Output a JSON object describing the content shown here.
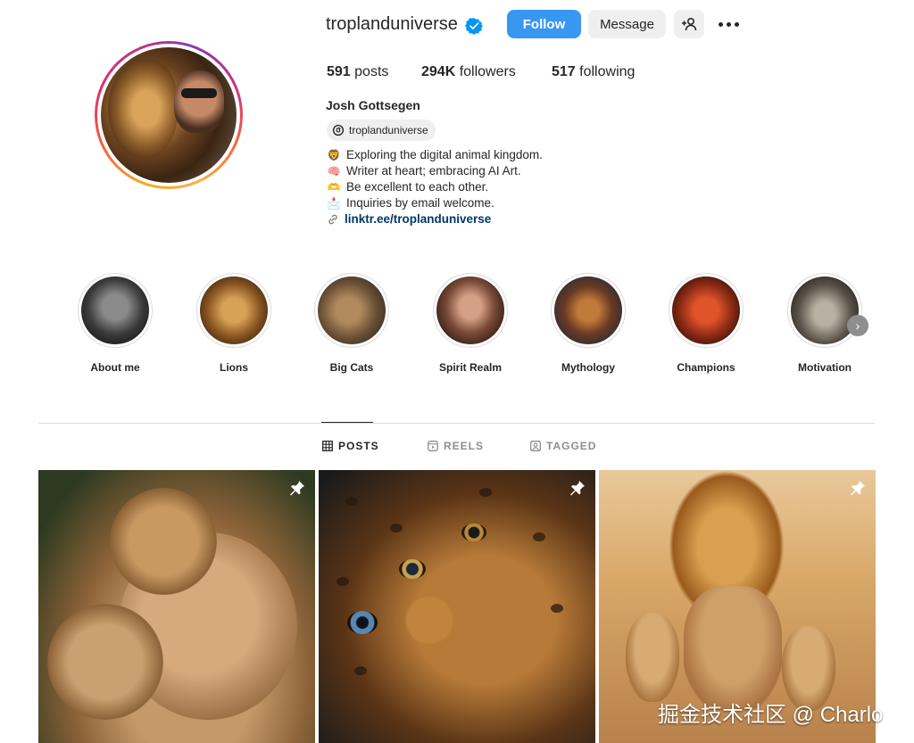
{
  "profile": {
    "username": "troplanduniverse",
    "follow_label": "Follow",
    "message_label": "Message",
    "posts_count": "591",
    "posts_label": "posts",
    "followers_count": "294K",
    "followers_label": "followers",
    "following_count": "517",
    "following_label": "following",
    "full_name": "Josh Gottsegen",
    "threads_handle": "troplanduniverse",
    "bio": [
      {
        "emoji": "🦁",
        "text": "Exploring the digital animal kingdom."
      },
      {
        "emoji": "🧠",
        "text": "Writer at heart; embracing AI Art."
      },
      {
        "emoji": "🫶",
        "text": "Be excellent to each other."
      },
      {
        "emoji": "📩",
        "text": "Inquiries by email welcome."
      }
    ],
    "link": "linktr.ee/troplanduniverse"
  },
  "highlights": [
    {
      "label": "About me"
    },
    {
      "label": "Lions"
    },
    {
      "label": "Big Cats"
    },
    {
      "label": "Spirit Realm"
    },
    {
      "label": "Mythology"
    },
    {
      "label": "Champions"
    },
    {
      "label": "Motivation"
    }
  ],
  "tabs": [
    {
      "label": "POSTS",
      "icon": "grid-icon",
      "active": true
    },
    {
      "label": "REELS",
      "icon": "reels-icon",
      "active": false
    },
    {
      "label": "TAGGED",
      "icon": "tagged-icon",
      "active": false
    }
  ],
  "colors": {
    "follow_blue": "#3897f0",
    "verified_blue": "#0095f6",
    "link_blue": "#00376b"
  },
  "watermark": "掘金技术社区 @ Charlo"
}
